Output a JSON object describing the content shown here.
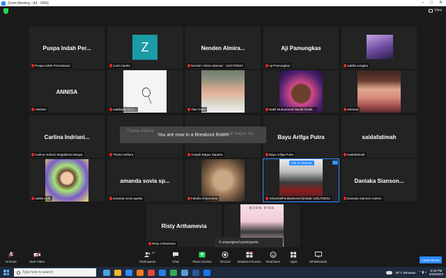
{
  "titlebar": {
    "title": "Zoom Meeting - A4 - VR61"
  },
  "topbar": {
    "view_label": "View"
  },
  "tiles": {
    "r1c1": {
      "display": "Puspa Indah Per...",
      "label": "Puspa Indah Permatasari"
    },
    "r1c2": {
      "avatar_letter": "Z",
      "label": "zoom baa04"
    },
    "r1c3": {
      "display": "Nenden  Almira...",
      "label": "Nenden Almira Marsad - 1201703022"
    },
    "r1c4": {
      "display": "Aji Pamungkas",
      "label": "Aji Pamungkas"
    },
    "r1c5": {
      "label": "nabilla sungkar"
    },
    "r2c1": {
      "display": "ANNISA",
      "label": "ANNISA"
    },
    "r2c2": {
      "label": "nabilla(ita S.Lu..."
    },
    "r2c3": {
      "label": "Tika Triani"
    },
    "r2c4": {
      "label": "Nabil Muhammad Naufal Dzaki ..."
    },
    "r2c5": {
      "label": "erkamia"
    },
    "r3c1": {
      "display": "Carlina  Indriani...",
      "label": "Carlina Indriani Magdalena Muaya"
    },
    "r3c2": {
      "display": "Thania Safiera",
      "label": "Thania Safiera"
    },
    "r3c3": {
      "display": "Joseph  Bagus  Sa...",
      "label": "Joseph Bagus Saputra"
    },
    "r3c4": {
      "display": "Bayu Arifga Putra",
      "label": "Bayu Arifga Putra"
    },
    "r3c5": {
      "display": "saidafatimah",
      "label": "saidafatimah"
    },
    "r4c1": {
      "label": "nabila syifa"
    },
    "r4c2": {
      "display": "amanda sovia sp...",
      "label": "amanda sovia sparky"
    },
    "r4c3": {
      "label": "Fabella charunnisa"
    },
    "r4c4": {
      "label": "YehezkielFerdianKevinTjimbak-1201703032"
    },
    "r4c5": {
      "display": "Daniaka  Sianson...",
      "label": "Daniaka Sianson Gultom"
    },
    "r5c1": {
      "display": "Risty Arthamevia",
      "label": "Risty Arthamevia"
    },
    "r5c2": {
      "poster_text": "BORN PINK"
    }
  },
  "breakout_message": "You are now in a Breakout Room",
  "ask_to_unmute": "Ask to Unmute",
  "more_dots": "...",
  "unassigned": "4 unassigned participants",
  "toolbar": {
    "unmute": "Unmute",
    "start_video": "Start Video",
    "participants": "Participants",
    "participants_count": "22",
    "chat": "Chat",
    "share_screen": "Share Screen",
    "record": "Record",
    "breakout_rooms": "Breakout Rooms",
    "reactions": "Reactions",
    "apps": "Apps",
    "whiteboards": "Whiteboards",
    "leave": "Leave Room"
  },
  "taskbar": {
    "search_placeholder": "Type here to search",
    "weather": "30°C  Berawan",
    "time": "6:43 PM",
    "date": "9/26/2022"
  },
  "colors": {
    "accent": "#2d8cff",
    "share_green": "#23d959",
    "mute_red": "#e02828"
  }
}
